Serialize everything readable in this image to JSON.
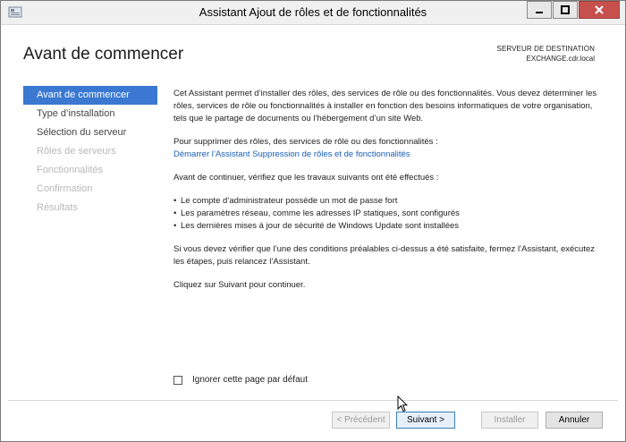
{
  "window": {
    "title": "Assistant Ajout de rôles et de fonctionnalités",
    "controls": {
      "minimize": "—",
      "maximize": "☐",
      "close": "✕"
    }
  },
  "page": {
    "title": "Avant de commencer",
    "destination_header": "SERVEUR DE DESTINATION",
    "destination_server": "EXCHANGE.cdr.local"
  },
  "nav": {
    "items": [
      {
        "label": "Avant de commencer",
        "state": "active"
      },
      {
        "label": "Type d’installation",
        "state": "normal"
      },
      {
        "label": "Sélection du serveur",
        "state": "normal"
      },
      {
        "label": "Rôles de serveurs",
        "state": "disabled"
      },
      {
        "label": "Fonctionnalités",
        "state": "disabled"
      },
      {
        "label": "Confirmation",
        "state": "disabled"
      },
      {
        "label": "Résultats",
        "state": "disabled"
      }
    ]
  },
  "content": {
    "intro": "Cet Assistant permet d’installer des rôles, des services de rôle ou des fonctionnalités. Vous devez déterminer les rôles, services de rôle ou fonctionnalités à installer en fonction des besoins informatiques de votre organisation, tels que le partage de documents ou l’hébergement d’un site Web.",
    "remove_intro": "Pour supprimer des rôles, des services de rôle ou des fonctionnalités :",
    "remove_link": "Démarrer l’Assistant Suppression de rôles et de fonctionnalités",
    "checks_intro": "Avant de continuer, vérifiez que les travaux suivants ont été effectués :",
    "bullets": [
      "Le compte d’administrateur possède un mot de passe fort",
      "Les paramètres réseau, comme les adresses IP statiques, sont configurés",
      "Les dernières mises à jour de sécurité de Windows Update sont installées"
    ],
    "prereq_note": "Si vous devez vérifier que l’une des conditions préalables ci-dessus a été satisfaite, fermez l’Assistant, exécutez les étapes, puis relancez l’Assistant.",
    "continue_note": "Cliquez sur Suivant pour continuer."
  },
  "options": {
    "ignore_label": "Ignorer cette page par défaut",
    "ignore_checked": false
  },
  "buttons": {
    "previous": "< Précédent",
    "next": "Suivant >",
    "install": "Installer",
    "cancel": "Annuler"
  },
  "colors": {
    "accent": "#3a78d2",
    "link": "#1a5fb4",
    "close_button": "#c7504d"
  }
}
